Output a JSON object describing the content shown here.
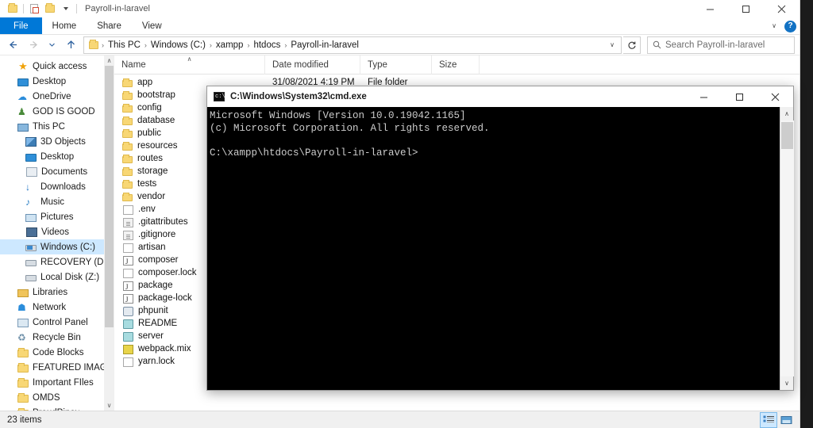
{
  "explorer": {
    "window_title": "Payroll-in-laravel",
    "quick_access_toolbar": [
      {
        "name": "folder-icon",
        "label": "Folder"
      },
      {
        "name": "properties-icon",
        "label": "Properties"
      },
      {
        "name": "new-folder-icon",
        "label": "New folder"
      },
      {
        "name": "customize-caret-icon",
        "label": "Customize Quick Access Toolbar"
      }
    ],
    "window_controls": {
      "minimize": "—",
      "maximize": "□",
      "close": "✕"
    },
    "ribbon_tabs": [
      {
        "label": "File",
        "active": true
      },
      {
        "label": "Home",
        "active": false
      },
      {
        "label": "Share",
        "active": false
      },
      {
        "label": "View",
        "active": false
      }
    ],
    "ribbon_right": {
      "expand_caret": "∨",
      "help_label": "?"
    },
    "address_bar": {
      "back": "←",
      "forward": "→",
      "recent": "∨",
      "up": "↑",
      "breadcrumbs": [
        "This PC",
        "Windows (C:)",
        "xampp",
        "htdocs",
        "Payroll-in-laravel"
      ],
      "separator": "›",
      "dropdown_caret": "∨",
      "refresh": "↻"
    },
    "search": {
      "icon": "search-icon",
      "placeholder": "Search Payroll-in-laravel"
    },
    "nav_pane": {
      "items": [
        {
          "label": "Quick access",
          "icon": "star-icon",
          "indent": 1,
          "selected": false
        },
        {
          "label": "Desktop",
          "icon": "monitor-icon",
          "indent": 1,
          "selected": false
        },
        {
          "label": "OneDrive",
          "icon": "cloud-icon",
          "indent": 1,
          "selected": false
        },
        {
          "label": "GOD IS GOOD",
          "icon": "user-icon",
          "indent": 1,
          "selected": false
        },
        {
          "label": "This PC",
          "icon": "pc-icon",
          "indent": 1,
          "selected": false
        },
        {
          "label": "3D Objects",
          "icon": "cube-icon",
          "indent": 2,
          "selected": false
        },
        {
          "label": "Desktop",
          "icon": "monitor-icon",
          "indent": 2,
          "selected": false
        },
        {
          "label": "Documents",
          "icon": "document-icon",
          "indent": 2,
          "selected": false
        },
        {
          "label": "Downloads",
          "icon": "download-icon",
          "indent": 2,
          "selected": false
        },
        {
          "label": "Music",
          "icon": "music-icon",
          "indent": 2,
          "selected": false
        },
        {
          "label": "Pictures",
          "icon": "picture-icon",
          "indent": 2,
          "selected": false
        },
        {
          "label": "Videos",
          "icon": "video-icon",
          "indent": 2,
          "selected": false
        },
        {
          "label": "Windows (C:)",
          "icon": "windows-drive-icon",
          "indent": 2,
          "selected": true
        },
        {
          "label": "RECOVERY (D:)",
          "icon": "drive-icon",
          "indent": 2,
          "selected": false
        },
        {
          "label": "Local Disk (Z:)",
          "icon": "drive-icon",
          "indent": 2,
          "selected": false
        },
        {
          "label": "Libraries",
          "icon": "library-icon",
          "indent": 1,
          "selected": false
        },
        {
          "label": "Network",
          "icon": "network-icon",
          "indent": 1,
          "selected": false
        },
        {
          "label": "Control Panel",
          "icon": "control-panel-icon",
          "indent": 1,
          "selected": false
        },
        {
          "label": "Recycle Bin",
          "icon": "recycle-bin-icon",
          "indent": 1,
          "selected": false
        },
        {
          "label": "Code Blocks",
          "icon": "folder-icon",
          "indent": 1,
          "selected": false
        },
        {
          "label": "FEATURED IMAGE TEMP",
          "icon": "folder-icon",
          "indent": 1,
          "selected": false
        },
        {
          "label": "Important FIles",
          "icon": "folder-icon",
          "indent": 1,
          "selected": false
        },
        {
          "label": "OMDS",
          "icon": "folder-icon",
          "indent": 1,
          "selected": false
        },
        {
          "label": "ProudPinoy",
          "icon": "folder-icon",
          "indent": 1,
          "selected": false
        }
      ],
      "scroll_up": "∧",
      "scroll_down": "∨"
    },
    "columns": [
      {
        "key": "name",
        "label": "Name",
        "sorted": true,
        "sort_caret": "∧"
      },
      {
        "key": "date",
        "label": "Date modified",
        "sorted": false
      },
      {
        "key": "type",
        "label": "Type",
        "sorted": false
      },
      {
        "key": "size",
        "label": "Size",
        "sorted": false
      }
    ],
    "files": [
      {
        "name": "app",
        "icon": "folder-icon",
        "date": "31/08/2021 4:19 PM",
        "type": "File folder",
        "size": ""
      },
      {
        "name": "bootstrap",
        "icon": "folder-icon",
        "date": "",
        "type": "",
        "size": ""
      },
      {
        "name": "config",
        "icon": "folder-icon",
        "date": "",
        "type": "",
        "size": ""
      },
      {
        "name": "database",
        "icon": "folder-icon",
        "date": "",
        "type": "",
        "size": ""
      },
      {
        "name": "public",
        "icon": "folder-icon",
        "date": "",
        "type": "",
        "size": ""
      },
      {
        "name": "resources",
        "icon": "folder-icon",
        "date": "",
        "type": "",
        "size": ""
      },
      {
        "name": "routes",
        "icon": "folder-icon",
        "date": "",
        "type": "",
        "size": ""
      },
      {
        "name": "storage",
        "icon": "folder-icon",
        "date": "",
        "type": "",
        "size": ""
      },
      {
        "name": "tests",
        "icon": "folder-icon",
        "date": "",
        "type": "",
        "size": ""
      },
      {
        "name": "vendor",
        "icon": "folder-icon",
        "date": "",
        "type": "",
        "size": ""
      },
      {
        "name": ".env",
        "icon": "file-icon",
        "date": "",
        "type": "",
        "size": ""
      },
      {
        "name": ".gitattributes",
        "icon": "text-file-icon",
        "date": "",
        "type": "",
        "size": ""
      },
      {
        "name": ".gitignore",
        "icon": "text-file-icon",
        "date": "",
        "type": "",
        "size": ""
      },
      {
        "name": "artisan",
        "icon": "file-icon",
        "date": "",
        "type": "",
        "size": ""
      },
      {
        "name": "composer",
        "icon": "json-file-icon",
        "date": "",
        "type": "",
        "size": ""
      },
      {
        "name": "composer.lock",
        "icon": "file-icon",
        "date": "",
        "type": "",
        "size": ""
      },
      {
        "name": "package",
        "icon": "json-file-icon",
        "date": "",
        "type": "",
        "size": ""
      },
      {
        "name": "package-lock",
        "icon": "json-file-icon",
        "date": "",
        "type": "",
        "size": ""
      },
      {
        "name": "phpunit",
        "icon": "php-file-icon",
        "date": "",
        "type": "",
        "size": ""
      },
      {
        "name": "README",
        "icon": "markdown-file-icon",
        "date": "",
        "type": "",
        "size": ""
      },
      {
        "name": "server",
        "icon": "markdown-file-icon",
        "date": "",
        "type": "",
        "size": ""
      },
      {
        "name": "webpack.mix",
        "icon": "js-file-icon",
        "date": "",
        "type": "",
        "size": ""
      },
      {
        "name": "yarn.lock",
        "icon": "file-icon",
        "date": "",
        "type": "",
        "size": ""
      }
    ],
    "status": {
      "item_count": "23 items",
      "view_buttons": [
        {
          "name": "details-view-button",
          "active": true
        },
        {
          "name": "large-icons-view-button",
          "active": false
        }
      ]
    }
  },
  "cmd": {
    "title": "C:\\Windows\\System32\\cmd.exe",
    "icon": "cmd-icon",
    "window_controls": {
      "minimize": "—",
      "maximize": "□",
      "close": "✕"
    },
    "console_text": "Microsoft Windows [Version 10.0.19042.1165]\n(c) Microsoft Corporation. All rights reserved.\n\nC:\\xampp\\htdocs\\Payroll-in-laravel>",
    "scroll_up": "∧",
    "scroll_down": "∨"
  }
}
